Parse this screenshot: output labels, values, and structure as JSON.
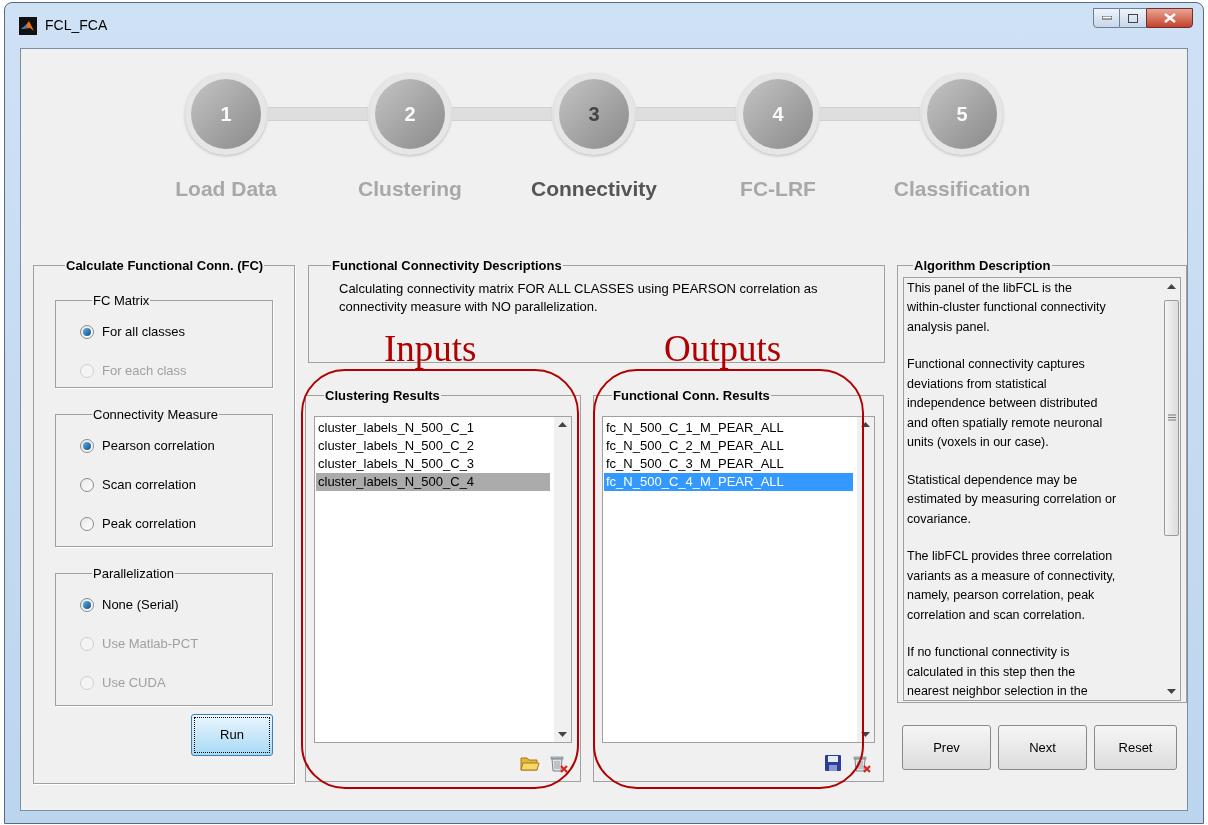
{
  "window": {
    "title": "FCL_FCA"
  },
  "steps": [
    {
      "number": "1",
      "label": "Load Data",
      "selected": false
    },
    {
      "number": "2",
      "label": "Clustering",
      "selected": false
    },
    {
      "number": "3",
      "label": "Connectivity",
      "selected": true
    },
    {
      "number": "4",
      "label": "FC-LRF",
      "selected": false
    },
    {
      "number": "5",
      "label": "Classification",
      "selected": false
    }
  ],
  "settings_panel": {
    "title": "Calculate Functional Conn. (FC)",
    "groups": [
      {
        "title": "FC Matrix",
        "options": [
          {
            "label": "For all classes",
            "selected": true,
            "disabled": false
          },
          {
            "label": "For each class",
            "selected": false,
            "disabled": true
          }
        ]
      },
      {
        "title": "Connectivity Measure",
        "options": [
          {
            "label": "Pearson correlation",
            "selected": true,
            "disabled": false
          },
          {
            "label": "Scan correlation",
            "selected": false,
            "disabled": false
          },
          {
            "label": "Peak correlation",
            "selected": false,
            "disabled": false
          }
        ]
      },
      {
        "title": "Parallelization",
        "options": [
          {
            "label": "None (Serial)",
            "selected": true,
            "disabled": false
          },
          {
            "label": "Use Matlab-PCT",
            "selected": false,
            "disabled": true
          },
          {
            "label": "Use CUDA",
            "selected": false,
            "disabled": true
          }
        ]
      }
    ],
    "run_button": "Run"
  },
  "description_panel": {
    "title": "Functional Connectivity Descriptions",
    "text": "Calculating connectivity matrix FOR ALL CLASSES using PEARSON correlation as\nconnectivity measure with NO parallelization."
  },
  "lists": [
    {
      "title": "Clustering Results",
      "focused": false,
      "items": [
        {
          "label": "cluster_labels_N_500_C_1",
          "selected": false
        },
        {
          "label": "cluster_labels_N_500_C_2",
          "selected": false
        },
        {
          "label": "cluster_labels_N_500_C_3",
          "selected": false
        },
        {
          "label": "cluster_labels_N_500_C_4",
          "selected": true
        }
      ],
      "actions": [
        {
          "kind": "open"
        },
        {
          "kind": "delete"
        }
      ]
    },
    {
      "title": "Functional Conn. Results",
      "focused": true,
      "items": [
        {
          "label": "fc_N_500_C_1_M_PEAR_ALL",
          "selected": false
        },
        {
          "label": "fc_N_500_C_2_M_PEAR_ALL",
          "selected": false
        },
        {
          "label": "fc_N_500_C_3_M_PEAR_ALL",
          "selected": false
        },
        {
          "label": "fc_N_500_C_4_M_PEAR_ALL",
          "selected": true
        }
      ],
      "actions": [
        {
          "kind": "save"
        },
        {
          "kind": "delete"
        }
      ]
    }
  ],
  "algorithm_panel": {
    "title": "Algorithm Description",
    "paragraphs": [
      "This panel of the libFCL is the\nwithin-cluster functional connectivity\nanalysis panel.",
      "Functional connectivity captures\ndeviations from statistical\nindependence between distributed\nand often spatially remote neuronal\nunits (voxels in our case).",
      "Statistical dependence may be\nestimated by measuring correlation or\ncovariance.",
      "The libFCL provides three correlation\nvariants as a measure of connectivity,\nnamely, pearson correlation, peak\ncorrelation and scan correlation.",
      "If no functional connectivity is\ncalculated in this step then the\nnearest neighbor selection in the"
    ]
  },
  "nav_buttons": [
    "Prev",
    "Next",
    "Reset"
  ],
  "annotations": [
    "Inputs",
    "Outputs"
  ]
}
